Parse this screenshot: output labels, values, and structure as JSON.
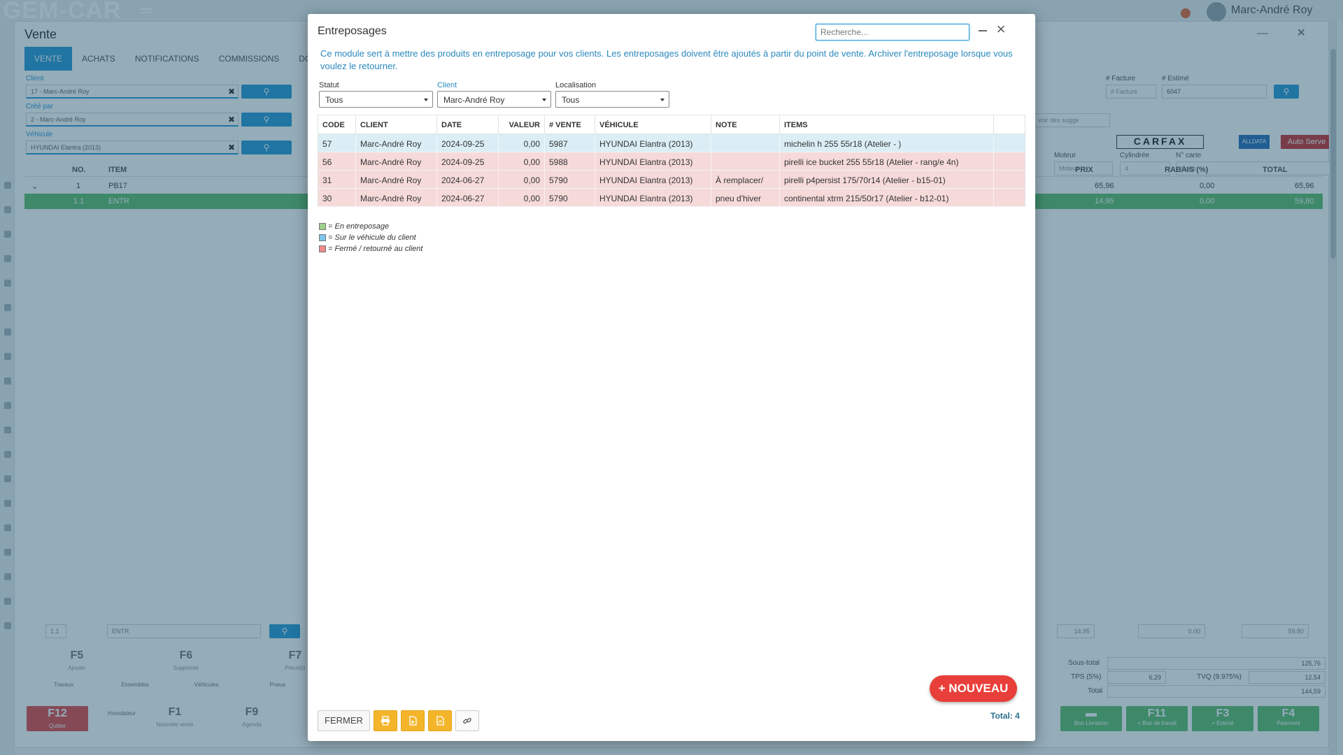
{
  "background_app": {
    "logo": "GEM-CAR",
    "user_name": "Marc-André Roy",
    "panel_title": "Vente",
    "tabs": [
      "VENTE",
      "ACHATS",
      "NOTIFICATIONS",
      "COMMISSIONS",
      "DOC"
    ],
    "client_label": "Client",
    "client_value": "17 - Marc-André Roy",
    "created_by_label": "Créé par",
    "created_by_value": "2 - Marc-André Roy",
    "vehicle_label": "Véhicule",
    "vehicle_value": "HYUNDAI Elantra (2013)",
    "invoice_label": "# Facture",
    "invoice_placeholder": "# Facture",
    "estimate_label": "# Estimé",
    "estimate_value": "6047",
    "motor_label": "Moteur",
    "motor_placeholder": "Moteur",
    "cylinder_label": "Cylindrée",
    "cylinder_value": "4",
    "card_label": "N° carte",
    "card_placeholder": "Carte",
    "suggest_placeholder": "voir des sugge",
    "carfax": "CARFAX",
    "alldata": "ALLDATA",
    "autoserve": "Auto Serve",
    "grid_headers": {
      "no": "NO.",
      "item": "ITEM",
      "prix": "PRIX",
      "rabais": "RABAIS (%)",
      "total": "TOTAL"
    },
    "grid_rows": [
      {
        "no": "1",
        "item": "PB17",
        "prix": "65,96",
        "rabais": "0,00",
        "total": "65,96"
      },
      {
        "no": "1.1",
        "item": "ENTR",
        "prix": "14,95",
        "rabais": "0,00",
        "total": "59,80"
      }
    ],
    "bottom_row": {
      "line": "1.1",
      "code": "ENTR",
      "price": "14.95",
      "discount": "0.00",
      "total": "59.80"
    },
    "fkeys": [
      {
        "key": "F5",
        "label": "Ajouter"
      },
      {
        "key": "F6",
        "label": "Supprimer"
      },
      {
        "key": "F7",
        "label": "Pièce(s)"
      }
    ],
    "small_keys": [
      "Travaux",
      "Ensembles",
      "Véhicules",
      "Pneus"
    ],
    "quit": {
      "key": "F12",
      "label": "Quitter"
    },
    "lower_keys": [
      {
        "key": "",
        "label": "Horodateur"
      },
      {
        "key": "F1",
        "label": "Nouvelle vente"
      },
      {
        "key": "F9",
        "label": "Agenda"
      }
    ],
    "right_keys": [
      {
        "key": "",
        "label": "Bon Livraison"
      },
      {
        "key": "F11",
        "label": "+ Bon de travail"
      },
      {
        "key": "F3",
        "label": "+ Estimé"
      },
      {
        "key": "F4",
        "label": "Paiement"
      }
    ],
    "totals": {
      "subtotal_label": "Sous-total",
      "subtotal": "125,76",
      "tps_label": "TPS (5%)",
      "tps": "6,29",
      "tvq_label": "TVQ (9.975%)",
      "tvq": "12,54",
      "total_label": "Total",
      "total": "144,59"
    }
  },
  "modal": {
    "title": "Entreposages",
    "search_placeholder": "Recherche...",
    "description": "Ce module sert à mettre des produits en entreposage pour vos clients. Les entreposages doivent être ajoutés à partir du point de vente. Archiver l'entreposage lorsque vous voulez le retourner.",
    "filters": {
      "status_label": "Statut",
      "status_value": "Tous",
      "client_label": "Client",
      "client_value": "Marc-André Roy",
      "location_label": "Localisation",
      "location_value": "Tous"
    },
    "columns": [
      "CODE",
      "CLIENT",
      "DATE",
      "VALEUR",
      "# VENTE",
      "VÉHICULE",
      "NOTE",
      "ITEMS"
    ],
    "rows": [
      {
        "code": "57",
        "client": "Marc-André Roy",
        "date": "2024-09-25",
        "valeur": "0,00",
        "vente": "5987",
        "vehicule": "HYUNDAI Elantra (2013)",
        "note": "",
        "items": "michelin h 255 55r18 (Atelier - )",
        "status": "vehicle"
      },
      {
        "code": "56",
        "client": "Marc-André Roy",
        "date": "2024-09-25",
        "valeur": "0,00",
        "vente": "5988",
        "vehicule": "HYUNDAI Elantra (2013)",
        "note": "",
        "items": "pirelli ice bucket 255 55r18 (Atelier - rang/e 4n)",
        "status": "closed"
      },
      {
        "code": "31",
        "client": "Marc-André Roy",
        "date": "2024-06-27",
        "valeur": "0,00",
        "vente": "5790",
        "vehicule": "HYUNDAI Elantra (2013)",
        "note": "À remplacer/",
        "items": "pirelli p4persist 175/70r14 (Atelier - b15-01)",
        "status": "closed"
      },
      {
        "code": "30",
        "client": "Marc-André Roy",
        "date": "2024-06-27",
        "valeur": "0,00",
        "vente": "5790",
        "vehicule": "HYUNDAI Elantra (2013)",
        "note": "pneu d'hiver",
        "items": "continental xtrm 215/50r17 (Atelier - b12-01)",
        "status": "closed"
      }
    ],
    "legend": [
      {
        "label": "= En entreposage",
        "color": "#9fd08a"
      },
      {
        "label": "= Sur le véhicule du client",
        "color": "#7cc6ea"
      },
      {
        "label": "= Fermé / retourné au client",
        "color": "#ef8a8a"
      }
    ],
    "row_colors": {
      "vehicle": "#dbeef6",
      "closed": "#f6dada",
      "stored": "#e2f2d9"
    },
    "new_button": "+ NOUVEAU",
    "total_text": "Total: 4",
    "close_button": "FERMER",
    "action_icons": [
      "print-icon",
      "excel-export-icon",
      "pdf-export-icon",
      "link-icon"
    ]
  }
}
